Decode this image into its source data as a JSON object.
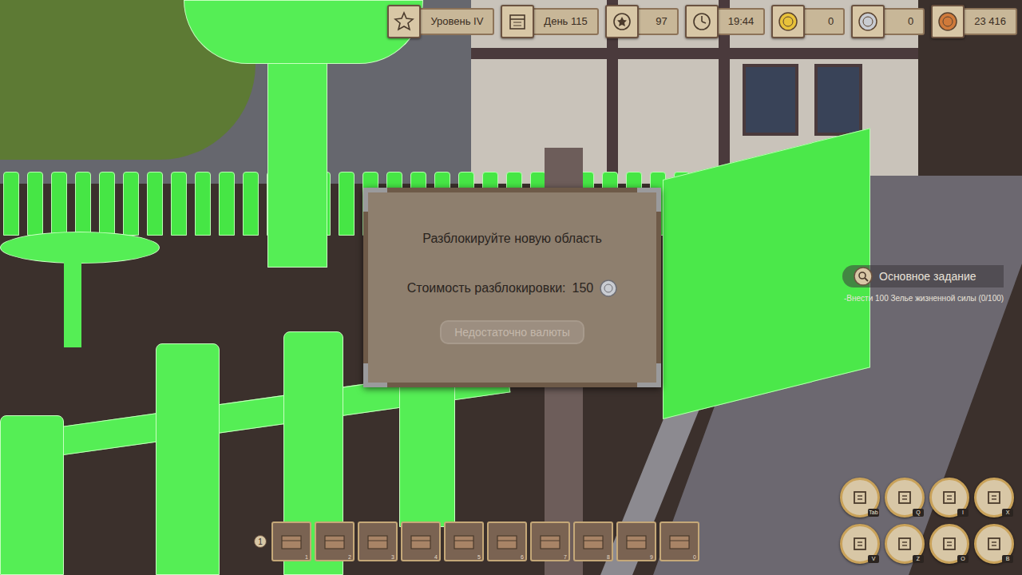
{
  "hud": [
    {
      "label": "Уровень IV",
      "kind": "level"
    },
    {
      "label": "День 115",
      "kind": "day"
    },
    {
      "label": "97",
      "kind": "rating"
    },
    {
      "label": "19:44",
      "kind": "time"
    },
    {
      "label": "0",
      "kind": "coin",
      "color": "#e8c23a"
    },
    {
      "label": "0",
      "kind": "coin",
      "color": "#c9ccd2"
    },
    {
      "label": "23 416",
      "kind": "coin",
      "color": "#d07a3a"
    }
  ],
  "dialog": {
    "title": "Разблокируйте новую область",
    "cost_label": "Стоимость разблокировки:",
    "cost": "150",
    "button": {
      "label": "Недостаточно валюты",
      "disabled": true
    }
  },
  "quest": {
    "title": "Основное задание",
    "task": "-Внести 100 Зелье жизненной силы (0/100)"
  },
  "hotbar": {
    "badge": "1",
    "slots": [
      {
        "key": "1"
      },
      {
        "key": "2"
      },
      {
        "key": "3"
      },
      {
        "key": "4"
      },
      {
        "key": "5"
      },
      {
        "key": "6"
      },
      {
        "key": "7"
      },
      {
        "key": "8"
      },
      {
        "key": "9"
      },
      {
        "key": "0"
      }
    ]
  },
  "menu": [
    {
      "key": "Tab"
    },
    {
      "key": "Q"
    },
    {
      "key": "I"
    },
    {
      "key": "X"
    },
    {
      "key": "V"
    },
    {
      "key": "Z"
    },
    {
      "key": "O"
    },
    {
      "key": "B"
    }
  ]
}
